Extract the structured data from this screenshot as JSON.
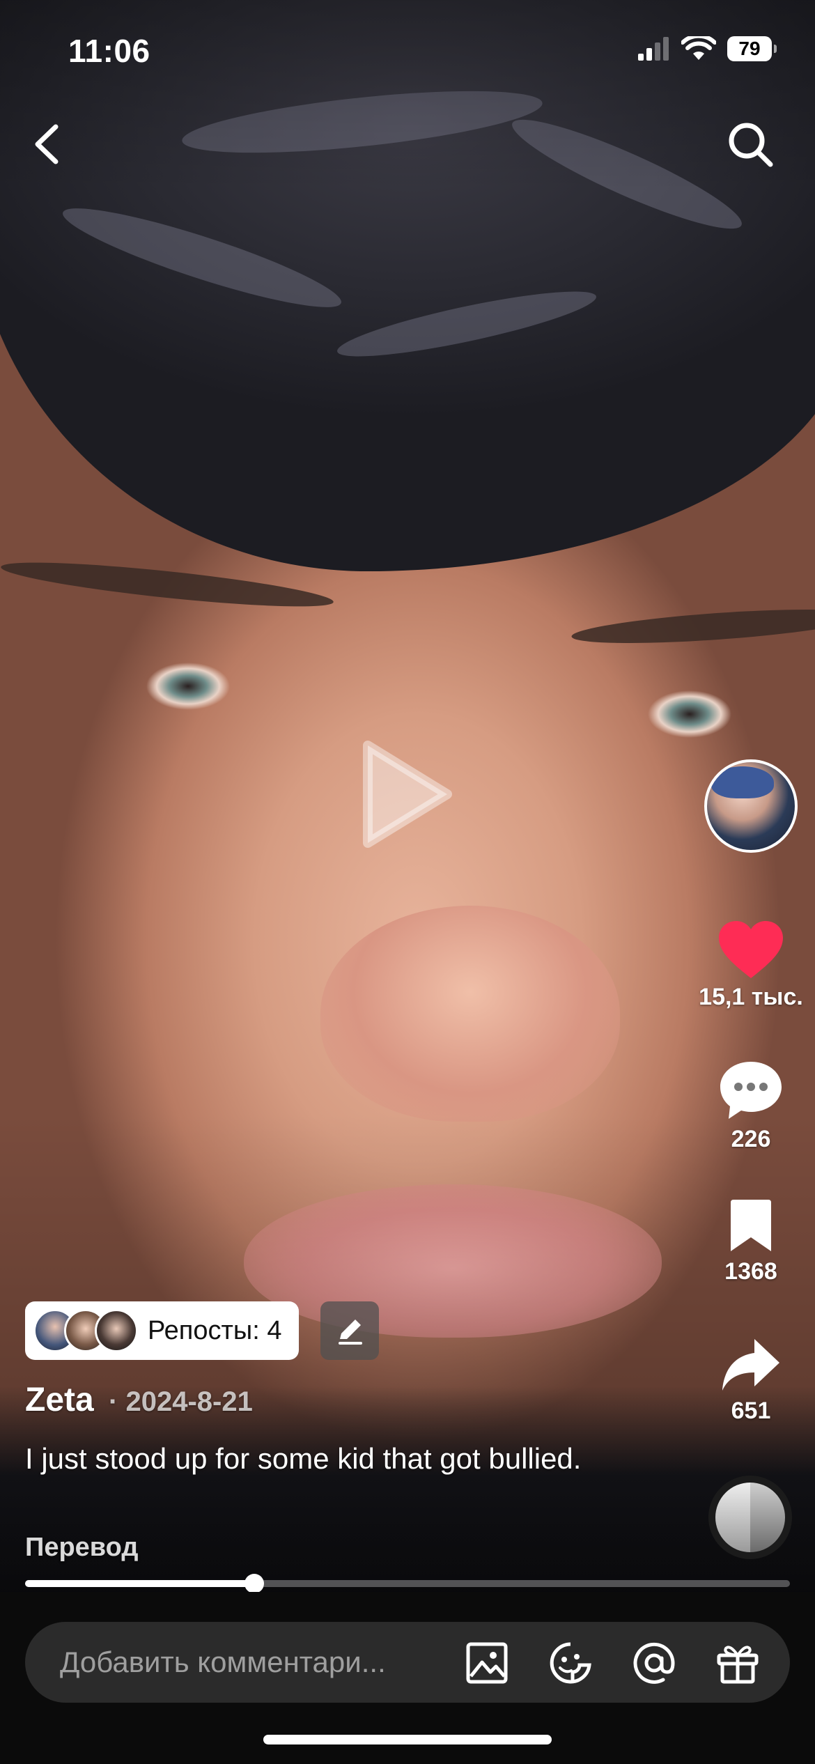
{
  "status_bar": {
    "time": "11:06",
    "battery": "79"
  },
  "nav": {
    "back_icon": "chevron-left-icon",
    "search_icon": "search-icon"
  },
  "actions": {
    "likes": "15,1 тыс.",
    "comments": "226",
    "saves": "1368",
    "shares": "651",
    "like_color": "#FE2C55"
  },
  "post": {
    "reposts_label": "Репосты: 4",
    "author": "Zeta",
    "date": "· 2024-8-21",
    "caption": "I just stood up for some kid that got bullied.",
    "translate_label": "Перевод",
    "progress_fraction": 0.3
  },
  "comment_bar": {
    "placeholder": "Добавить комментари...",
    "icons": [
      "image-icon",
      "sticker-icon",
      "mention-icon",
      "gift-icon"
    ]
  }
}
